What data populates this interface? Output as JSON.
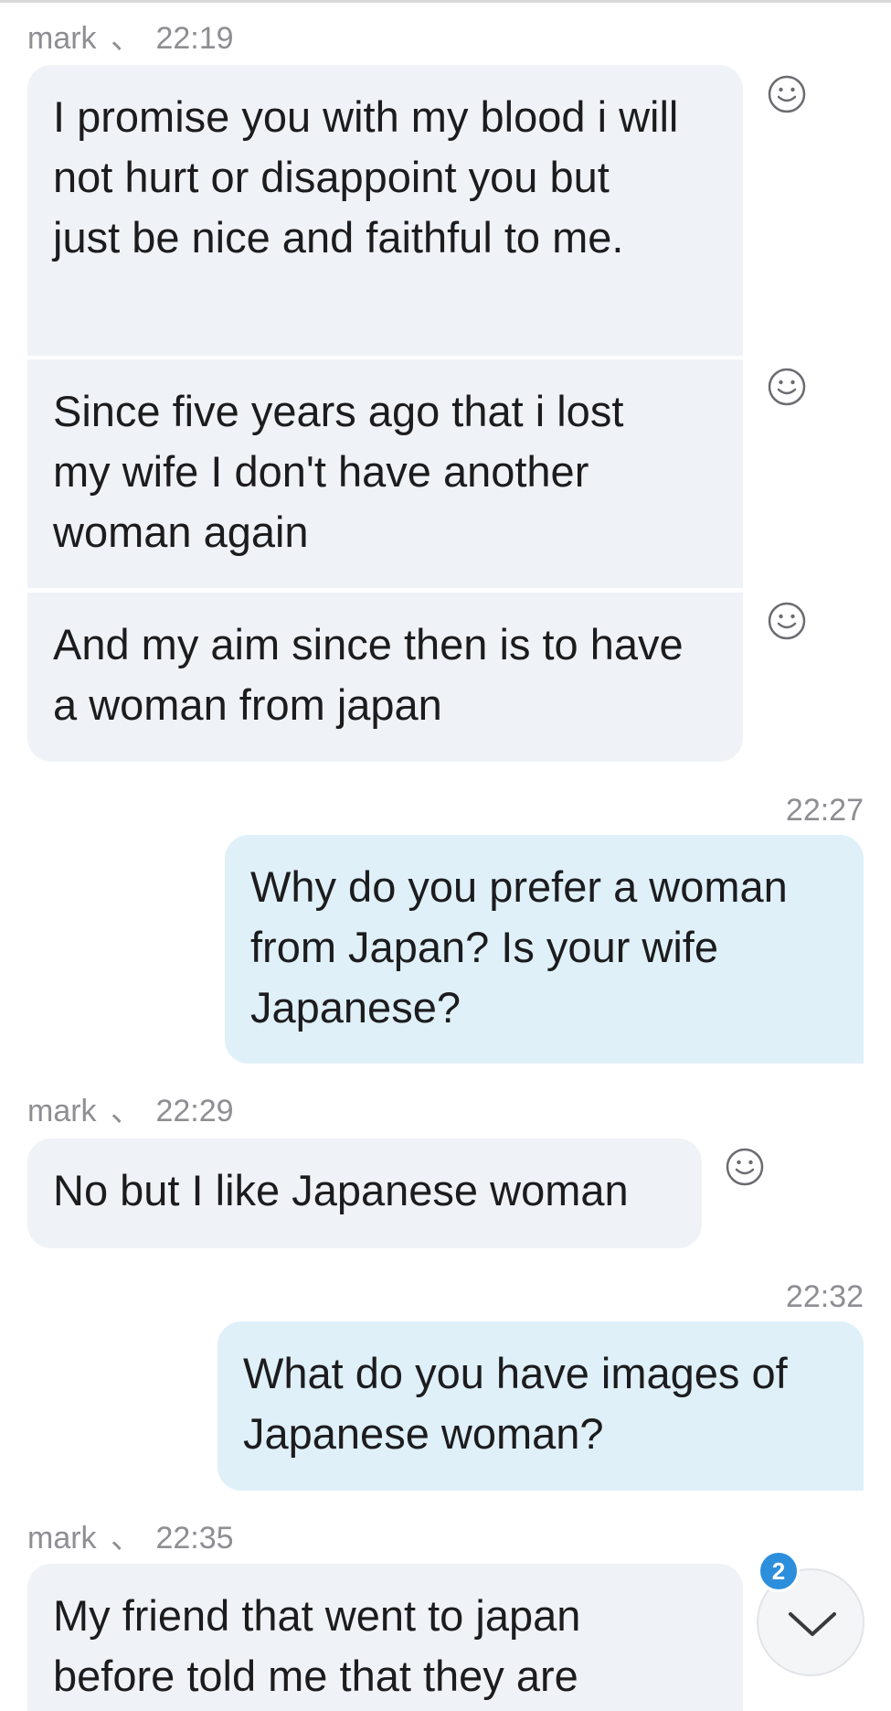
{
  "messages": [
    {
      "sender": "mark",
      "sep": "、",
      "time": "22:19",
      "texts": [
        "I promise you with my blood i will not hurt or disappoint you but just be nice and faithful to me.",
        "Since five years ago that i lost my wife I don't have another woman again",
        "And my aim since then is to have a woman from japan"
      ]
    },
    {
      "time": "22:27",
      "text": "Why do you prefer a woman from Japan? Is your wife Japanese?"
    },
    {
      "sender": "mark",
      "sep": "、",
      "time": "22:29",
      "texts": [
        "No but I like Japanese woman"
      ]
    },
    {
      "time": "22:32",
      "text": "What do you have images of Japanese woman?"
    },
    {
      "sender": "mark",
      "sep": "、",
      "time": "22:35",
      "texts": [
        "My friend that went to japan before told me that they are"
      ]
    }
  ],
  "scroll_button": {
    "unread_count": "2",
    "icon": "chevron-down-icon"
  },
  "colors": {
    "incoming_bubble": "#eff3f7",
    "outgoing_bubble": "#dff0f9",
    "badge": "#2d8fdc",
    "meta_text": "#8e8e93"
  }
}
